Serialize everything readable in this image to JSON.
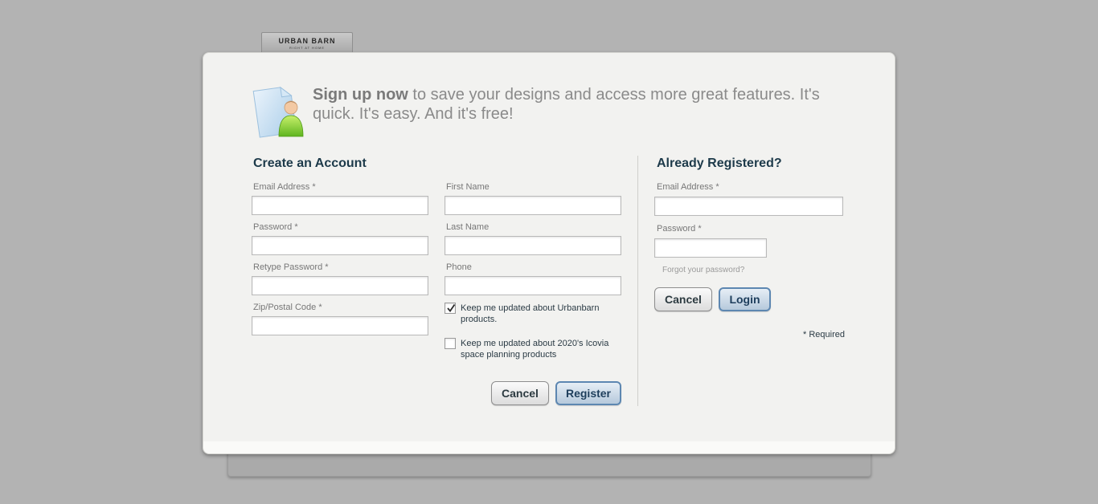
{
  "brand": {
    "name": "URBAN BARN",
    "tagline": "RIGHT AT HOME"
  },
  "promo": {
    "bold": "Sign up now",
    "text": " to save your designs and access more great features.  It's quick.  It's easy.  And it's free!",
    "icon": "new-user-document-icon"
  },
  "create_account": {
    "title": "Create an Account",
    "email_label": "Email Address *",
    "password_label": "Password *",
    "retype_password_label": "Retype Password *",
    "zip_label": "Zip/Postal Code *",
    "first_name_label": "First Name",
    "last_name_label": "Last Name",
    "phone_label": "Phone",
    "email_value": "",
    "password_value": "",
    "retype_password_value": "",
    "zip_value": "",
    "first_name_value": "",
    "last_name_value": "",
    "phone_value": "",
    "checkbox_urbanbarn": {
      "label": "Keep me updated about Urbanbarn products.",
      "checked": true
    },
    "checkbox_icovia": {
      "label": "Keep me updated about 2020's Icovia space planning products",
      "checked": false
    },
    "cancel_label": "Cancel",
    "register_label": "Register"
  },
  "login": {
    "title": "Already Registered?",
    "email_label": "Email Address *",
    "password_label": "Password *",
    "email_value": "",
    "password_value": "",
    "forgot_label": "Forgot your password?",
    "cancel_label": "Cancel",
    "login_label": "Login",
    "required_note": "* Required"
  },
  "colors": {
    "accent": "#5d87b1",
    "heading": "#1d3a4a",
    "background": "#b3b3b3",
    "modal": "#f2f2f0"
  }
}
